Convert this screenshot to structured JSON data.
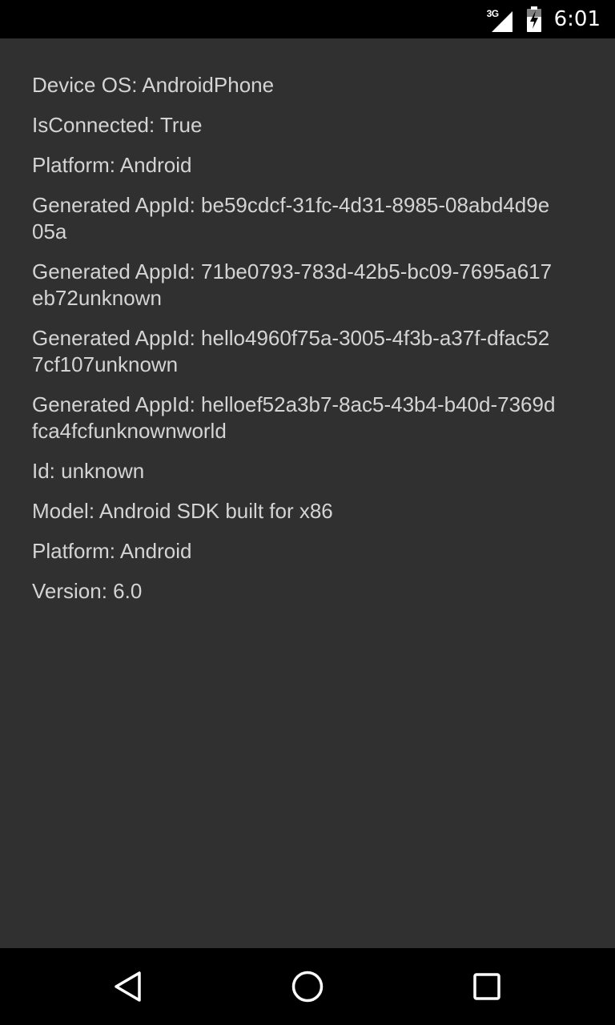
{
  "status_bar": {
    "network_type": "3G",
    "time": "6:01"
  },
  "info_lines": [
    "Device OS: AndroidPhone",
    "IsConnected: True",
    "Platform: Android",
    "Generated AppId: be59cdcf-31fc-4d31-8985-08abd4d9e05a",
    "Generated AppId: 71be0793-783d-42b5-bc09-7695a617eb72unknown",
    "Generated AppId: hello4960f75a-3005-4f3b-a37f-dfac527cf107unknown",
    "Generated AppId: helloef52a3b7-8ac5-43b4-b40d-7369dfca4fcfunknownworld",
    "Id: unknown",
    "Model: Android SDK built for x86",
    "Platform: Android",
    "Version: 6.0"
  ],
  "nav_bar": {
    "icons": [
      "back-icon",
      "home-icon",
      "recents-icon"
    ]
  },
  "colors": {
    "background": "#303030",
    "text": "#d4d4d4",
    "bars": "#000000"
  }
}
